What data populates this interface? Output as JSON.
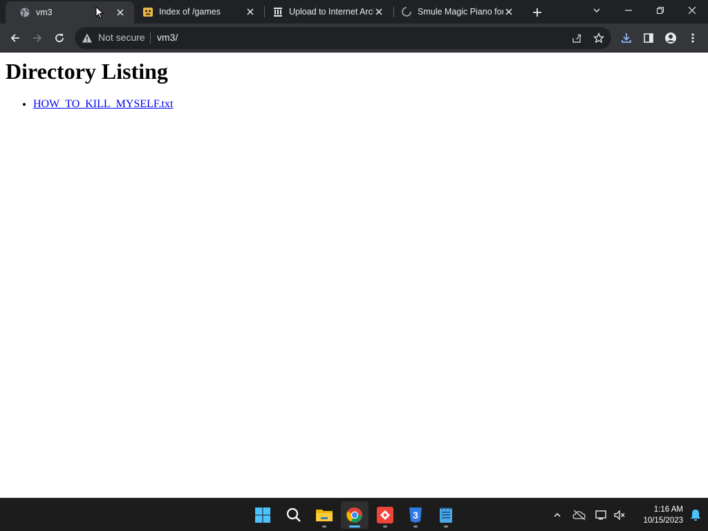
{
  "browser": {
    "tabs": [
      {
        "title": "vm3",
        "favicon": "globe-icon",
        "active": true
      },
      {
        "title": "Index of /games",
        "favicon": "games-favicon",
        "active": false
      },
      {
        "title": "Upload to Internet Arch",
        "favicon": "internet-archive-icon",
        "active": false
      },
      {
        "title": "Smule Magic Piano for",
        "favicon": "loading-spinner-icon",
        "active": false
      }
    ],
    "omnibox": {
      "security_status": "Not secure",
      "url": "vm3/"
    }
  },
  "page": {
    "heading": "Directory Listing",
    "files": [
      {
        "name": "HOW_TO_KILL_MYSELF.txt"
      }
    ]
  },
  "taskbar": {
    "apps": [
      "windows-start-icon",
      "search-icon",
      "file-explorer-icon",
      "chrome-icon",
      "anydesk-icon",
      "three-app-icon",
      "notepad-icon"
    ],
    "time": "1:16 AM",
    "date": "10/15/2023"
  },
  "colors": {
    "titlebar": "#202124",
    "toolbar": "#35363a",
    "link": "#0000ee",
    "taskbar": "#1c1c1c",
    "accent": "#4cc2ff"
  }
}
